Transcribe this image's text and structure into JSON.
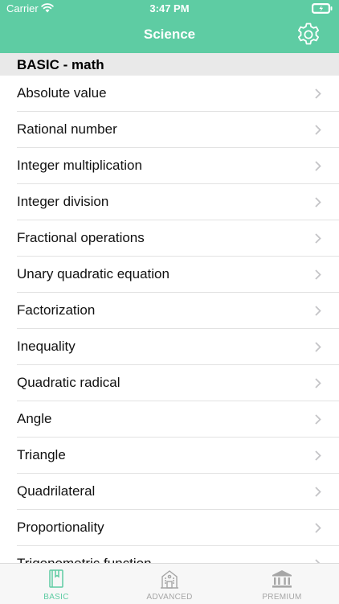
{
  "status_bar": {
    "carrier": "Carrier",
    "time": "3:47 PM"
  },
  "nav": {
    "title": "Science"
  },
  "section": {
    "title": "BASIC - math"
  },
  "items": [
    "Absolute value",
    "Rational number",
    "Integer multiplication",
    "Integer division",
    "Fractional operations",
    "Unary quadratic equation",
    "Factorization",
    "Inequality",
    "Quadratic radical",
    "Angle",
    "Triangle",
    "Quadrilateral",
    "Proportionality",
    "Trigonometric function"
  ],
  "tabs": [
    {
      "label": "BASIC",
      "icon": "book-icon",
      "active": true
    },
    {
      "label": "ADVANCED",
      "icon": "building-icon",
      "active": false
    },
    {
      "label": "PREMIUM",
      "icon": "bank-icon",
      "active": false
    }
  ],
  "colors": {
    "accent": "#5ecca3",
    "tab_active": "#5ecca3",
    "tab_inactive": "#a6a6a6",
    "battery": "#5ecca3"
  }
}
